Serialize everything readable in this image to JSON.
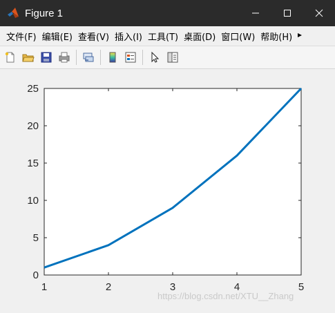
{
  "window": {
    "title": "Figure 1",
    "minimize_icon": "minimize-icon",
    "maximize_icon": "maximize-icon",
    "close_icon": "close-icon"
  },
  "menubar": {
    "items": [
      "文件(F)",
      "编辑(E)",
      "查看(V)",
      "插入(I)",
      "工具(T)",
      "桌面(D)",
      "窗口(W)",
      "帮助(H)"
    ],
    "overflow_icon": "chevron-right-icon"
  },
  "toolbar": {
    "buttons": [
      "new-figure-icon",
      "open-file-icon",
      "save-icon",
      "print-icon",
      "link-plot-icon",
      "colorbar-icon",
      "legend-icon",
      "pointer-icon",
      "property-editor-icon"
    ]
  },
  "watermark": "https://blog.csdn.net/XTU__Zhang",
  "chart_data": {
    "type": "line",
    "x": [
      1,
      2,
      3,
      4,
      5
    ],
    "series": [
      {
        "values": [
          1,
          4,
          9,
          16,
          25
        ],
        "color": "#0072bd"
      }
    ],
    "xlim": [
      1,
      5
    ],
    "ylim": [
      0,
      25
    ],
    "xticks": [
      "1",
      "2",
      "3",
      "4",
      "5"
    ],
    "yticks": [
      "0",
      "5",
      "10",
      "15",
      "20",
      "25"
    ],
    "grid": false
  }
}
